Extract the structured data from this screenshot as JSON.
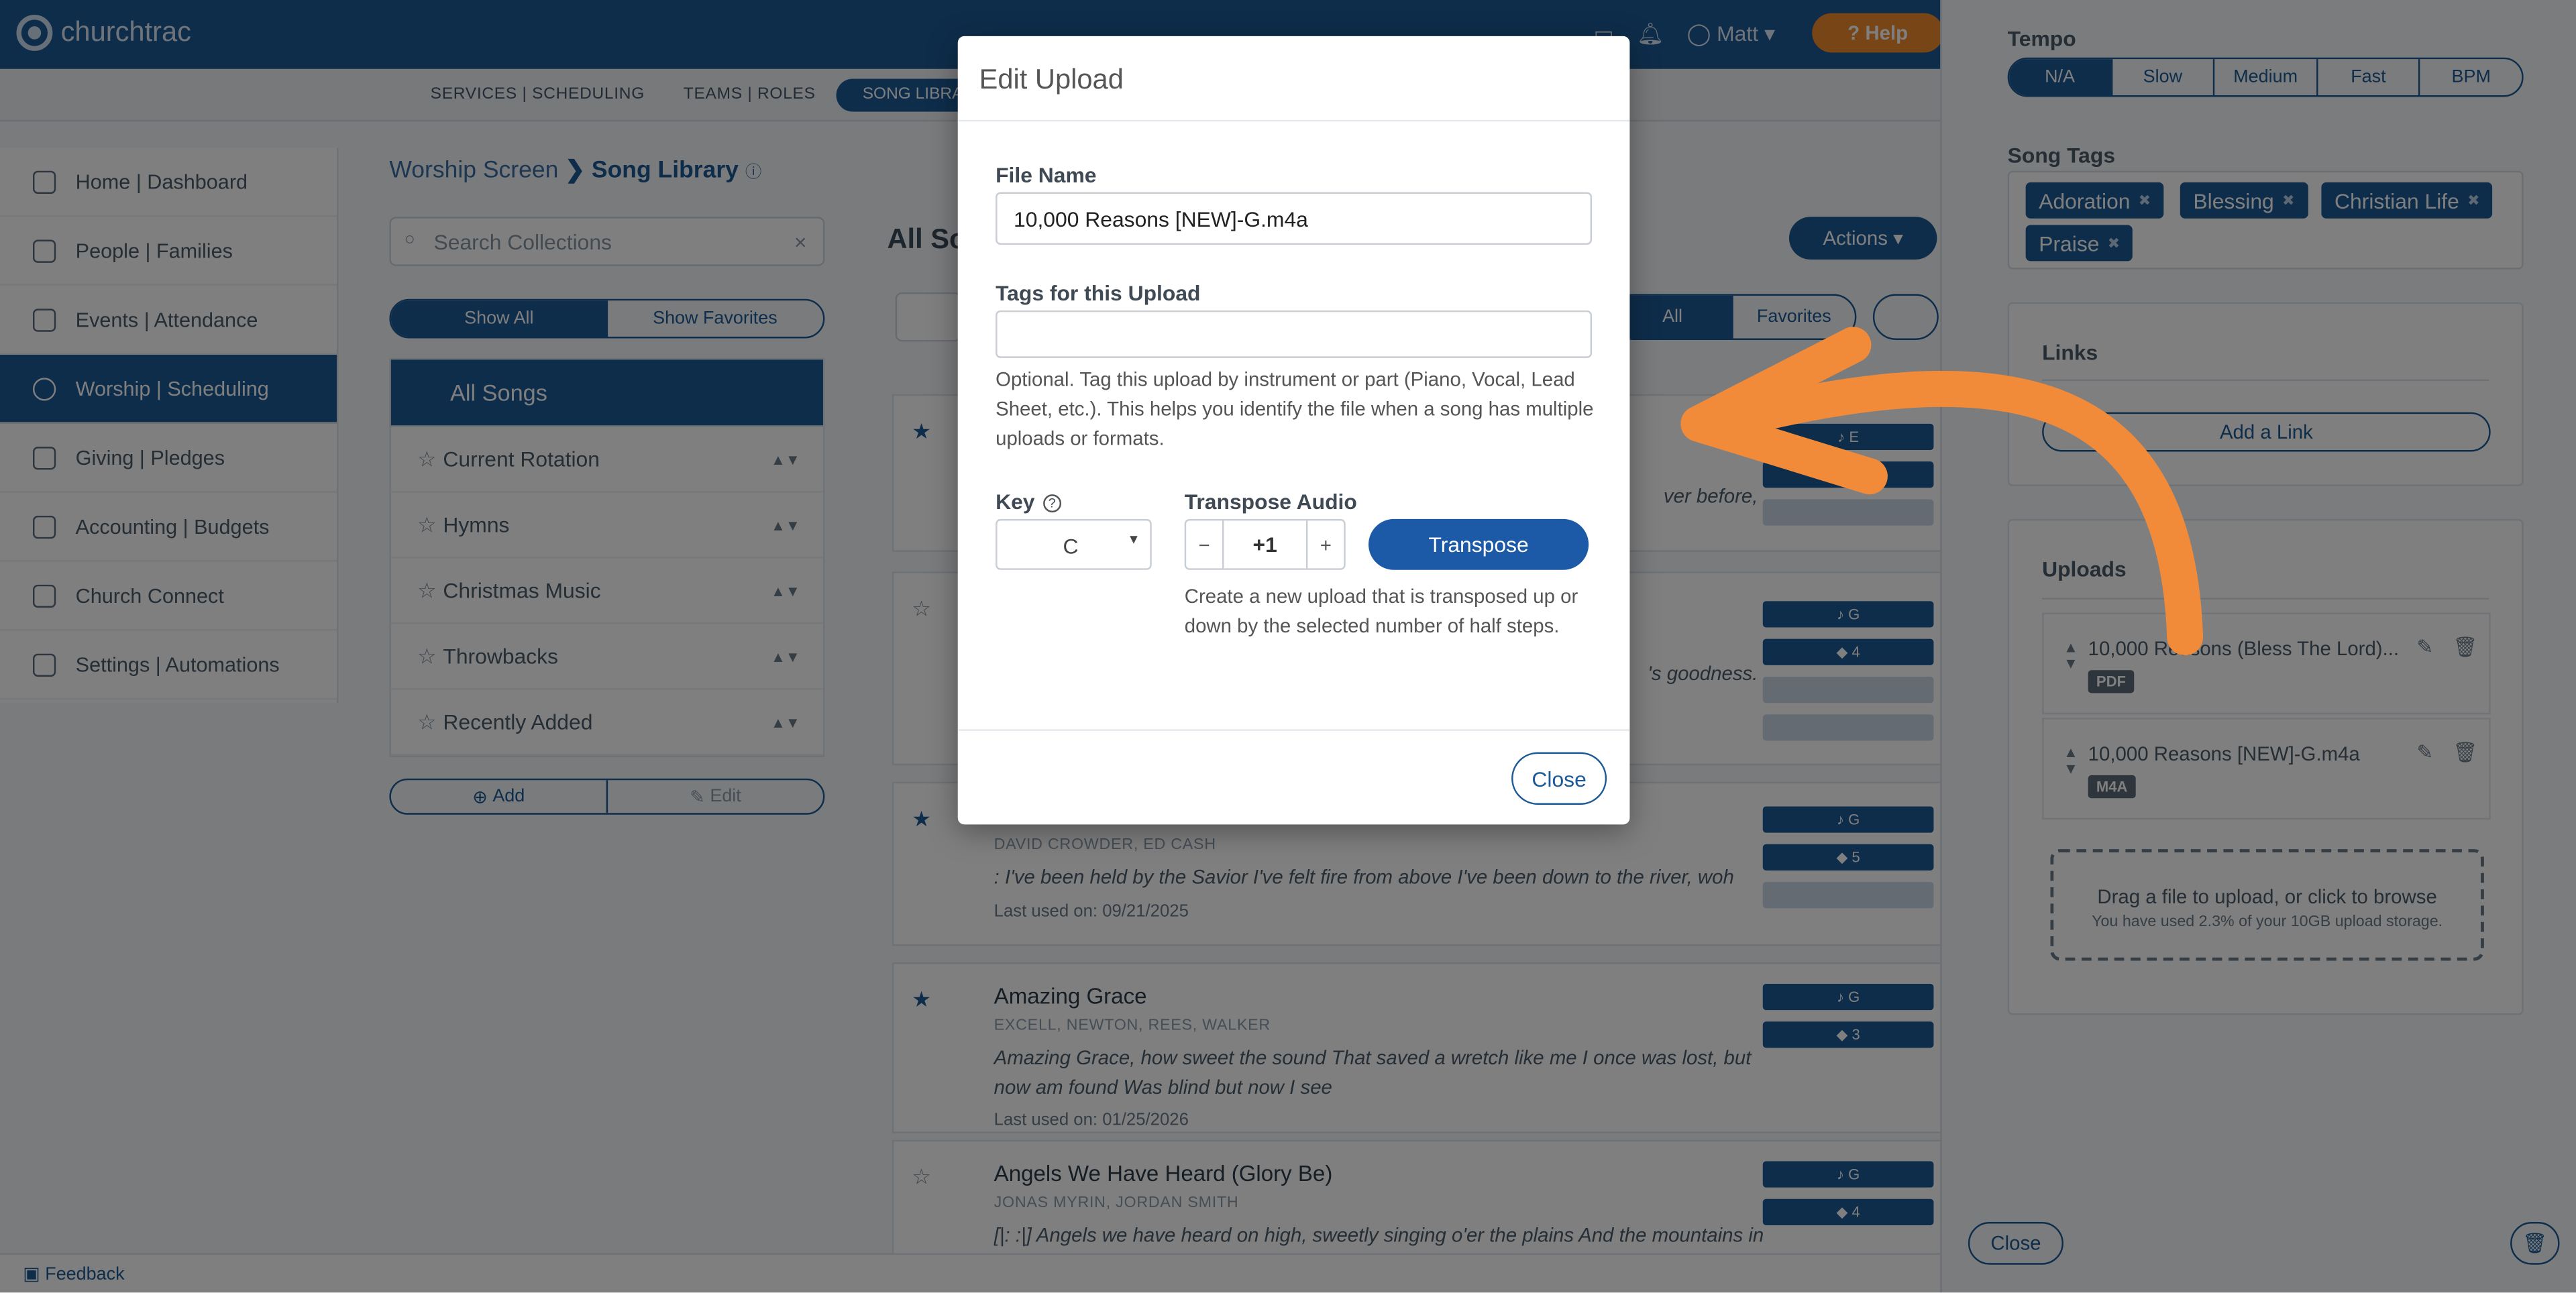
{
  "app": {
    "brand": "churchtrac",
    "help_label": "Help",
    "user_label": "Matt"
  },
  "colors": {
    "primary": "#1c5a97",
    "accent_orange": "#f28b39",
    "backdrop": "rgba(0,0,0,0.5)"
  },
  "subnav": {
    "items": [
      "SERVICES | SCHEDULING",
      "TEAMS | ROLES"
    ],
    "active": "SONG LIBRARY"
  },
  "sidebar": {
    "items": [
      {
        "label": "Home | Dashboard",
        "icon": "home-icon"
      },
      {
        "label": "People | Families",
        "icon": "people-icon"
      },
      {
        "label": "Events | Attendance",
        "icon": "calendar-icon"
      },
      {
        "label": "Worship | Scheduling",
        "icon": "music-icon",
        "active": true
      },
      {
        "label": "Giving | Pledges",
        "icon": "giving-icon"
      },
      {
        "label": "Accounting | Budgets",
        "icon": "ledger-icon"
      },
      {
        "label": "Church Connect",
        "icon": "phone-icon"
      },
      {
        "label": "Settings | Automations",
        "icon": "gear-icon"
      }
    ]
  },
  "breadcrumb": {
    "parent": "Worship Screen",
    "current": "Song Library"
  },
  "collections": {
    "search_placeholder": "Search Collections",
    "filter": [
      "Show All",
      "Show Favorites"
    ],
    "header": "All Songs",
    "items": [
      "Current Rotation",
      "Hymns",
      "Christmas Music",
      "Throwbacks",
      "Recently Added"
    ],
    "add_label": "Add",
    "edit_label": "Edit"
  },
  "songs": {
    "title": "All So",
    "actions_label": "Actions",
    "filter": [
      "All",
      "Favorites"
    ],
    "list": [
      {
        "title": "",
        "authors": "",
        "lyrics": "ver before,",
        "last_used": "",
        "key": "E"
      },
      {
        "title": "",
        "authors": "",
        "lyrics": "'s goodness.",
        "last_used": "",
        "key": "G",
        "tags": "4"
      },
      {
        "title": "",
        "authors": "DAVID CROWDER, ED CASH",
        "lyrics": ": I've been held by the Savior I've felt fire from above I've been down to the river, woh",
        "last_used": "Last used on: 09/21/2025",
        "key": "G",
        "tags": "5"
      },
      {
        "title": "Amazing Grace",
        "authors": "EXCELL, NEWTON, REES, WALKER",
        "lyrics": "Amazing Grace, how sweet the sound That saved a wretch like me I once was lost, but now am found Was blind but now I see",
        "last_used": "Last used on: 01/25/2026",
        "key": "G",
        "tags": "3"
      },
      {
        "title": "Angels We Have Heard (Glory Be)",
        "authors": "JONAS MYRIN, JORDAN SMITH",
        "lyrics": "[|: :|] Angels we have heard on high, sweetly singing o'er the plains And the mountains in",
        "last_used": "",
        "key": "G",
        "tags": "4"
      }
    ]
  },
  "feedback_label": "Feedback",
  "panel": {
    "tempo_label": "Tempo",
    "tempo_options": [
      "N/A",
      "Slow",
      "Medium",
      "Fast",
      "BPM"
    ],
    "tempo_selected": "N/A",
    "song_tags_label": "Song Tags",
    "song_tags": [
      "Adoration",
      "Blessing",
      "Christian Life",
      "Praise"
    ],
    "links_label": "Links",
    "add_link_label": "Add a Link",
    "uploads_label": "Uploads",
    "uploads": [
      {
        "name": "10,000 Reasons (Bless The Lord)...",
        "type": "PDF"
      },
      {
        "name": "10,000 Reasons [NEW]-G.m4a",
        "type": "M4A"
      }
    ],
    "drop_title": "Drag a file to upload, or click to browse",
    "drop_usage": "You have used 2.3% of your 10GB upload storage.",
    "close_label": "Close"
  },
  "modal": {
    "title": "Edit Upload",
    "file_name_label": "File Name",
    "file_name_value": "10,000 Reasons [NEW]-G.m4a",
    "tags_label": "Tags for this Upload",
    "tags_value": "",
    "tags_help": "Optional. Tag this upload by instrument or part (Piano, Vocal, Lead Sheet, etc.). This helps you identify the file when a song has multiple uploads or formats.",
    "key_label": "Key",
    "key_value": "C",
    "transpose_label": "Transpose Audio",
    "transpose_value": "+1",
    "transpose_button": "Transpose",
    "transpose_help": "Create a new upload that is transposed up or down by the selected number of half steps.",
    "close_label": "Close"
  }
}
